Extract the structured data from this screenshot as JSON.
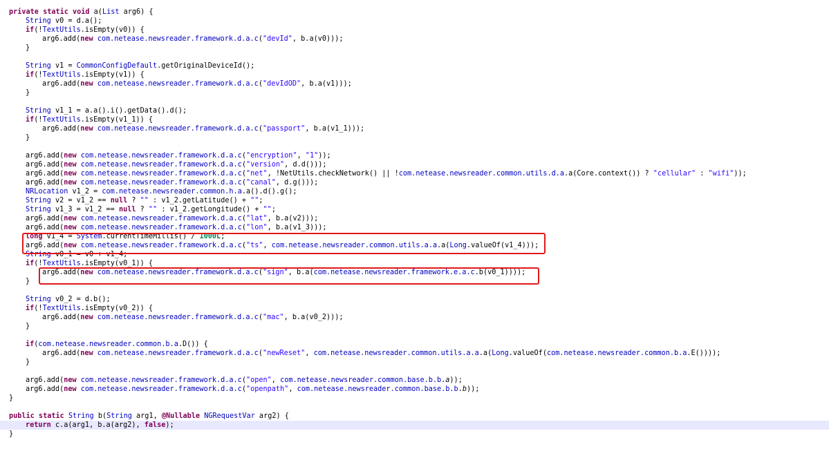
{
  "highlight_color": "#e01818",
  "current_line_color": "#e8e8ff",
  "code_lines": [
    {
      "indent": 0,
      "tokens": [
        {
          "t": "private static void ",
          "c": "kw"
        },
        {
          "t": "a(",
          "c": ""
        },
        {
          "t": "List",
          "c": "ty"
        },
        {
          "t": " arg6) {",
          "c": ""
        }
      ]
    },
    {
      "indent": 1,
      "tokens": [
        {
          "t": "String",
          "c": "ty"
        },
        {
          "t": " v0 = d.a();",
          "c": ""
        }
      ]
    },
    {
      "indent": 1,
      "tokens": [
        {
          "t": "if",
          "c": "kw"
        },
        {
          "t": "(!",
          "c": ""
        },
        {
          "t": "TextUtils",
          "c": "ty"
        },
        {
          "t": ".isEmpty(v0)) {",
          "c": ""
        }
      ]
    },
    {
      "indent": 2,
      "tokens": [
        {
          "t": "arg6.add(",
          "c": ""
        },
        {
          "t": "new",
          "c": "kw"
        },
        {
          "t": " ",
          "c": ""
        },
        {
          "t": "com.netease.newsreader.framework.d.a.c",
          "c": "ty"
        },
        {
          "t": "(",
          "c": ""
        },
        {
          "t": "\"devId\"",
          "c": "st"
        },
        {
          "t": ", b.a(v0)));",
          "c": ""
        }
      ]
    },
    {
      "indent": 1,
      "tokens": [
        {
          "t": "}",
          "c": ""
        }
      ]
    },
    {
      "indent": 0,
      "tokens": []
    },
    {
      "indent": 1,
      "tokens": [
        {
          "t": "String",
          "c": "ty"
        },
        {
          "t": " v1 = ",
          "c": ""
        },
        {
          "t": "CommonConfigDefault",
          "c": "ty"
        },
        {
          "t": ".getOriginalDeviceId();",
          "c": ""
        }
      ]
    },
    {
      "indent": 1,
      "tokens": [
        {
          "t": "if",
          "c": "kw"
        },
        {
          "t": "(!",
          "c": ""
        },
        {
          "t": "TextUtils",
          "c": "ty"
        },
        {
          "t": ".isEmpty(v1)) {",
          "c": ""
        }
      ]
    },
    {
      "indent": 2,
      "tokens": [
        {
          "t": "arg6.add(",
          "c": ""
        },
        {
          "t": "new",
          "c": "kw"
        },
        {
          "t": " ",
          "c": ""
        },
        {
          "t": "com.netease.newsreader.framework.d.a.c",
          "c": "ty"
        },
        {
          "t": "(",
          "c": ""
        },
        {
          "t": "\"devIdOD\"",
          "c": "st"
        },
        {
          "t": ", b.a(v1)));",
          "c": ""
        }
      ]
    },
    {
      "indent": 1,
      "tokens": [
        {
          "t": "}",
          "c": ""
        }
      ]
    },
    {
      "indent": 0,
      "tokens": []
    },
    {
      "indent": 1,
      "tokens": [
        {
          "t": "String",
          "c": "ty"
        },
        {
          "t": " v1_1 = a.a().i().getData().d();",
          "c": ""
        }
      ]
    },
    {
      "indent": 1,
      "tokens": [
        {
          "t": "if",
          "c": "kw"
        },
        {
          "t": "(!",
          "c": ""
        },
        {
          "t": "TextUtils",
          "c": "ty"
        },
        {
          "t": ".isEmpty(v1_1)) {",
          "c": ""
        }
      ]
    },
    {
      "indent": 2,
      "tokens": [
        {
          "t": "arg6.add(",
          "c": ""
        },
        {
          "t": "new",
          "c": "kw"
        },
        {
          "t": " ",
          "c": ""
        },
        {
          "t": "com.netease.newsreader.framework.d.a.c",
          "c": "ty"
        },
        {
          "t": "(",
          "c": ""
        },
        {
          "t": "\"passport\"",
          "c": "st"
        },
        {
          "t": ", b.a(v1_1)));",
          "c": ""
        }
      ]
    },
    {
      "indent": 1,
      "tokens": [
        {
          "t": "}",
          "c": ""
        }
      ]
    },
    {
      "indent": 0,
      "tokens": []
    },
    {
      "indent": 1,
      "tokens": [
        {
          "t": "arg6.add(",
          "c": ""
        },
        {
          "t": "new",
          "c": "kw"
        },
        {
          "t": " ",
          "c": ""
        },
        {
          "t": "com.netease.newsreader.framework.d.a.c",
          "c": "ty"
        },
        {
          "t": "(",
          "c": ""
        },
        {
          "t": "\"encryption\"",
          "c": "st"
        },
        {
          "t": ", ",
          "c": ""
        },
        {
          "t": "\"1\"",
          "c": "st"
        },
        {
          "t": "));",
          "c": ""
        }
      ]
    },
    {
      "indent": 1,
      "tokens": [
        {
          "t": "arg6.add(",
          "c": ""
        },
        {
          "t": "new",
          "c": "kw"
        },
        {
          "t": " ",
          "c": ""
        },
        {
          "t": "com.netease.newsreader.framework.d.a.c",
          "c": "ty"
        },
        {
          "t": "(",
          "c": ""
        },
        {
          "t": "\"version\"",
          "c": "st"
        },
        {
          "t": ", d.d()));",
          "c": ""
        }
      ]
    },
    {
      "indent": 1,
      "tokens": [
        {
          "t": "arg6.add(",
          "c": ""
        },
        {
          "t": "new",
          "c": "kw"
        },
        {
          "t": " ",
          "c": ""
        },
        {
          "t": "com.netease.newsreader.framework.d.a.c",
          "c": "ty"
        },
        {
          "t": "(",
          "c": ""
        },
        {
          "t": "\"net\"",
          "c": "st"
        },
        {
          "t": ", !NetUtils.checkNetwork() || !",
          "c": ""
        },
        {
          "t": "com.netease.newsreader.common.utils.d.a",
          "c": "ty"
        },
        {
          "t": ".a(Core.context()) ? ",
          "c": ""
        },
        {
          "t": "\"cellular\"",
          "c": "st"
        },
        {
          "t": " : ",
          "c": ""
        },
        {
          "t": "\"wifi\"",
          "c": "st"
        },
        {
          "t": "));",
          "c": ""
        }
      ]
    },
    {
      "indent": 1,
      "tokens": [
        {
          "t": "arg6.add(",
          "c": ""
        },
        {
          "t": "new",
          "c": "kw"
        },
        {
          "t": " ",
          "c": ""
        },
        {
          "t": "com.netease.newsreader.framework.d.a.c",
          "c": "ty"
        },
        {
          "t": "(",
          "c": ""
        },
        {
          "t": "\"canal\"",
          "c": "st"
        },
        {
          "t": ", d.g()));",
          "c": ""
        }
      ]
    },
    {
      "indent": 1,
      "tokens": [
        {
          "t": "NRLocation",
          "c": "ty"
        },
        {
          "t": " v1_2 = ",
          "c": ""
        },
        {
          "t": "com.netease.newsreader.common.h.a",
          "c": "ty"
        },
        {
          "t": ".a().d().g();",
          "c": ""
        }
      ]
    },
    {
      "indent": 1,
      "tokens": [
        {
          "t": "String",
          "c": "ty"
        },
        {
          "t": " v2 = v1_2 == ",
          "c": ""
        },
        {
          "t": "null",
          "c": "bo"
        },
        {
          "t": " ? ",
          "c": ""
        },
        {
          "t": "\"\"",
          "c": "st"
        },
        {
          "t": " : v1_2.getLatitude() + ",
          "c": ""
        },
        {
          "t": "\"\"",
          "c": "st"
        },
        {
          "t": ";",
          "c": ""
        }
      ]
    },
    {
      "indent": 1,
      "tokens": [
        {
          "t": "String",
          "c": "ty"
        },
        {
          "t": " v1_3 = v1_2 == ",
          "c": ""
        },
        {
          "t": "null",
          "c": "bo"
        },
        {
          "t": " ? ",
          "c": ""
        },
        {
          "t": "\"\"",
          "c": "st"
        },
        {
          "t": " : v1_2.getLongitude() + ",
          "c": ""
        },
        {
          "t": "\"\"",
          "c": "st"
        },
        {
          "t": ";",
          "c": ""
        }
      ]
    },
    {
      "indent": 1,
      "tokens": [
        {
          "t": "arg6.add(",
          "c": ""
        },
        {
          "t": "new",
          "c": "kw"
        },
        {
          "t": " ",
          "c": ""
        },
        {
          "t": "com.netease.newsreader.framework.d.a.c",
          "c": "ty"
        },
        {
          "t": "(",
          "c": ""
        },
        {
          "t": "\"lat\"",
          "c": "st"
        },
        {
          "t": ", b.a(v2)));",
          "c": ""
        }
      ]
    },
    {
      "indent": 1,
      "tokens": [
        {
          "t": "arg6.add(",
          "c": ""
        },
        {
          "t": "new",
          "c": "kw"
        },
        {
          "t": " ",
          "c": ""
        },
        {
          "t": "com.netease.newsreader.framework.d.a.c",
          "c": "ty"
        },
        {
          "t": "(",
          "c": ""
        },
        {
          "t": "\"lon\"",
          "c": "st"
        },
        {
          "t": ", b.a(v1_3)));",
          "c": ""
        }
      ]
    },
    {
      "indent": 1,
      "tokens": [
        {
          "t": "long",
          "c": "kw"
        },
        {
          "t": " v1_4 = ",
          "c": ""
        },
        {
          "t": "System",
          "c": "ty"
        },
        {
          "t": ".currentTimeMillis() / ",
          "c": ""
        },
        {
          "t": "1000L",
          "c": "nm"
        },
        {
          "t": ";",
          "c": ""
        }
      ]
    },
    {
      "indent": 1,
      "tokens": [
        {
          "t": "arg6.add(",
          "c": ""
        },
        {
          "t": "new",
          "c": "kw"
        },
        {
          "t": " ",
          "c": ""
        },
        {
          "t": "com.netease.newsreader.framework.d.a.c",
          "c": "ty"
        },
        {
          "t": "(",
          "c": ""
        },
        {
          "t": "\"ts\"",
          "c": "st"
        },
        {
          "t": ", ",
          "c": ""
        },
        {
          "t": "com.netease.newsreader.common.utils.a.a",
          "c": "ty"
        },
        {
          "t": ".a(",
          "c": ""
        },
        {
          "t": "Long",
          "c": "ty"
        },
        {
          "t": ".valueOf(v1_4)));",
          "c": ""
        }
      ]
    },
    {
      "indent": 1,
      "tokens": [
        {
          "t": "String",
          "c": "ty"
        },
        {
          "t": " v0_1 = v0 + v1_4;",
          "c": ""
        }
      ]
    },
    {
      "indent": 1,
      "tokens": [
        {
          "t": "if",
          "c": "kw"
        },
        {
          "t": "(!",
          "c": ""
        },
        {
          "t": "TextUtils",
          "c": "ty"
        },
        {
          "t": ".isEmpty(v0_1)) {",
          "c": ""
        }
      ]
    },
    {
      "indent": 2,
      "tokens": [
        {
          "t": "arg6.add(",
          "c": ""
        },
        {
          "t": "new",
          "c": "kw"
        },
        {
          "t": " ",
          "c": ""
        },
        {
          "t": "com.netease.newsreader.framework.d.a.c",
          "c": "ty"
        },
        {
          "t": "(",
          "c": ""
        },
        {
          "t": "\"sign\"",
          "c": "st"
        },
        {
          "t": ", b.a(",
          "c": ""
        },
        {
          "t": "com.netease.newsreader.framework.e.a.c",
          "c": "ty"
        },
        {
          "t": ".b(v0_1))));",
          "c": ""
        }
      ]
    },
    {
      "indent": 1,
      "tokens": [
        {
          "t": "}",
          "c": ""
        }
      ]
    },
    {
      "indent": 0,
      "tokens": []
    },
    {
      "indent": 1,
      "tokens": [
        {
          "t": "String",
          "c": "ty"
        },
        {
          "t": " v0_2 = d.b();",
          "c": ""
        }
      ]
    },
    {
      "indent": 1,
      "tokens": [
        {
          "t": "if",
          "c": "kw"
        },
        {
          "t": "(!",
          "c": ""
        },
        {
          "t": "TextUtils",
          "c": "ty"
        },
        {
          "t": ".isEmpty(v0_2)) {",
          "c": ""
        }
      ]
    },
    {
      "indent": 2,
      "tokens": [
        {
          "t": "arg6.add(",
          "c": ""
        },
        {
          "t": "new",
          "c": "kw"
        },
        {
          "t": " ",
          "c": ""
        },
        {
          "t": "com.netease.newsreader.framework.d.a.c",
          "c": "ty"
        },
        {
          "t": "(",
          "c": ""
        },
        {
          "t": "\"mac\"",
          "c": "st"
        },
        {
          "t": ", b.a(v0_2)));",
          "c": ""
        }
      ]
    },
    {
      "indent": 1,
      "tokens": [
        {
          "t": "}",
          "c": ""
        }
      ]
    },
    {
      "indent": 0,
      "tokens": []
    },
    {
      "indent": 1,
      "tokens": [
        {
          "t": "if",
          "c": "kw"
        },
        {
          "t": "(",
          "c": ""
        },
        {
          "t": "com.netease.newsreader.common.b.a",
          "c": "ty"
        },
        {
          "t": ".D()) {",
          "c": ""
        }
      ]
    },
    {
      "indent": 2,
      "tokens": [
        {
          "t": "arg6.add(",
          "c": ""
        },
        {
          "t": "new",
          "c": "kw"
        },
        {
          "t": " ",
          "c": ""
        },
        {
          "t": "com.netease.newsreader.framework.d.a.c",
          "c": "ty"
        },
        {
          "t": "(",
          "c": ""
        },
        {
          "t": "\"newReset\"",
          "c": "st"
        },
        {
          "t": ", ",
          "c": ""
        },
        {
          "t": "com.netease.newsreader.common.utils.a.a",
          "c": "ty"
        },
        {
          "t": ".a(",
          "c": ""
        },
        {
          "t": "Long",
          "c": "ty"
        },
        {
          "t": ".valueOf(",
          "c": ""
        },
        {
          "t": "com.netease.newsreader.common.b.a",
          "c": "ty"
        },
        {
          "t": ".E())));",
          "c": ""
        }
      ]
    },
    {
      "indent": 1,
      "tokens": [
        {
          "t": "}",
          "c": ""
        }
      ]
    },
    {
      "indent": 0,
      "tokens": []
    },
    {
      "indent": 1,
      "tokens": [
        {
          "t": "arg6.add(",
          "c": ""
        },
        {
          "t": "new",
          "c": "kw"
        },
        {
          "t": " ",
          "c": ""
        },
        {
          "t": "com.netease.newsreader.framework.d.a.c",
          "c": "ty"
        },
        {
          "t": "(",
          "c": ""
        },
        {
          "t": "\"open\"",
          "c": "st"
        },
        {
          "t": ", ",
          "c": ""
        },
        {
          "t": "com.netease.newsreader.common.base.b.b",
          "c": "ty"
        },
        {
          "t": ".",
          "c": ""
        },
        {
          "t": "a",
          "c": "it"
        },
        {
          "t": "));",
          "c": ""
        }
      ]
    },
    {
      "indent": 1,
      "tokens": [
        {
          "t": "arg6.add(",
          "c": ""
        },
        {
          "t": "new",
          "c": "kw"
        },
        {
          "t": " ",
          "c": ""
        },
        {
          "t": "com.netease.newsreader.framework.d.a.c",
          "c": "ty"
        },
        {
          "t": "(",
          "c": ""
        },
        {
          "t": "\"openpath\"",
          "c": "st"
        },
        {
          "t": ", ",
          "c": ""
        },
        {
          "t": "com.netease.newsreader.common.base.b.b",
          "c": "ty"
        },
        {
          "t": ".",
          "c": ""
        },
        {
          "t": "b",
          "c": "it"
        },
        {
          "t": "));",
          "c": ""
        }
      ]
    },
    {
      "indent": 0,
      "tokens": [
        {
          "t": "}",
          "c": ""
        }
      ]
    },
    {
      "indent": 0,
      "tokens": []
    },
    {
      "indent": 0,
      "tokens": [
        {
          "t": "public static ",
          "c": "kw"
        },
        {
          "t": "String",
          "c": "ty"
        },
        {
          "t": " b(",
          "c": ""
        },
        {
          "t": "String",
          "c": "ty"
        },
        {
          "t": " arg1, ",
          "c": ""
        },
        {
          "t": "@Nullable",
          "c": "kw"
        },
        {
          "t": " ",
          "c": ""
        },
        {
          "t": "NGRequestVar",
          "c": "ty"
        },
        {
          "t": " arg2) {",
          "c": ""
        }
      ]
    },
    {
      "indent": 1,
      "current": true,
      "tokens": [
        {
          "t": "return",
          "c": "kw"
        },
        {
          "t": " c.a(arg1, b.a(arg2), ",
          "c": ""
        },
        {
          "t": "false",
          "c": "bo"
        },
        {
          "t": ");",
          "c": ""
        }
      ]
    },
    {
      "indent": 0,
      "tokens": [
        {
          "t": "}",
          "c": ""
        }
      ]
    }
  ]
}
